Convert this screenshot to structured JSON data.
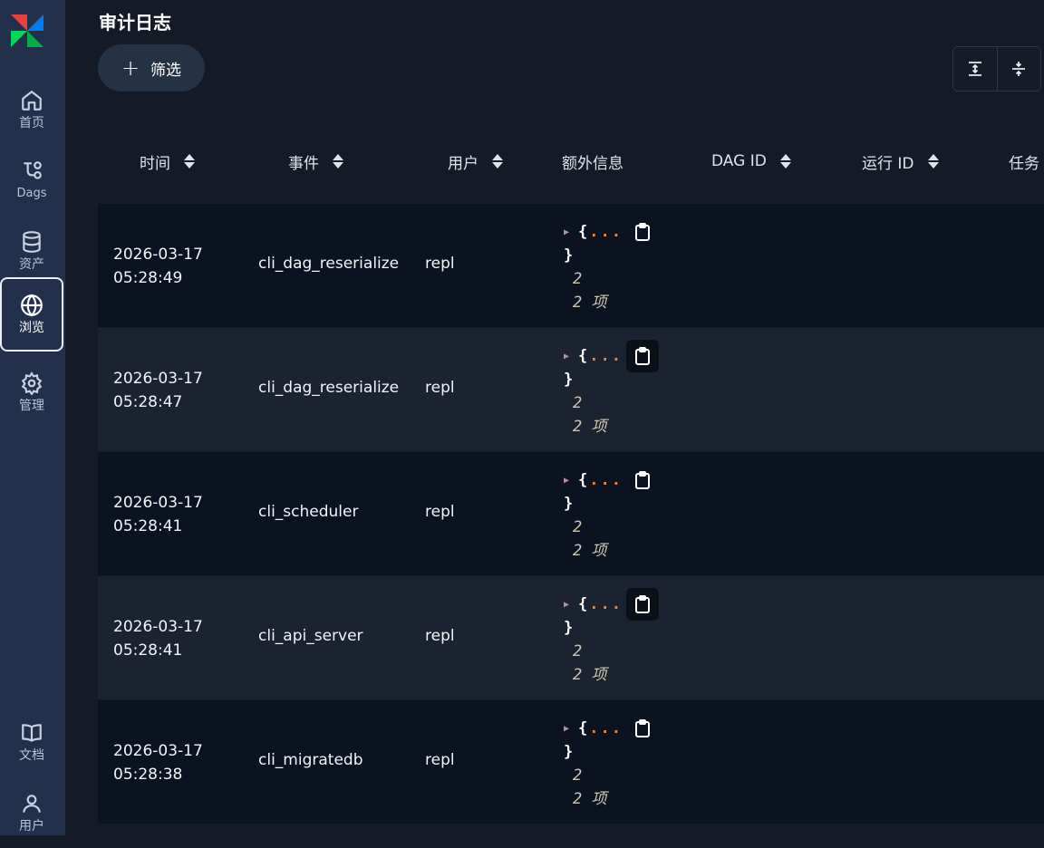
{
  "page": {
    "title": "审计日志"
  },
  "toolbar": {
    "filter_label": "筛选"
  },
  "sidebar": {
    "items": [
      {
        "label": "首页",
        "icon": "home-icon"
      },
      {
        "label": "Dags",
        "icon": "dag-icon"
      },
      {
        "label": "资产",
        "icon": "database-icon"
      },
      {
        "label": "浏览",
        "icon": "globe-icon",
        "active": true
      },
      {
        "label": "管理",
        "icon": "gear-icon"
      },
      {
        "label": "文档",
        "icon": "book-icon"
      },
      {
        "label": "用户",
        "icon": "user-icon"
      }
    ]
  },
  "table": {
    "columns": [
      "时间",
      "事件",
      "用户",
      "额外信息",
      "DAG ID",
      "运行 ID",
      "任务"
    ],
    "rows": [
      {
        "date": "2026-03-17",
        "time": "05:28:49",
        "event": "cli_dag_reserialize",
        "user": "repl",
        "extra_count": "2",
        "extra_items": "2 项"
      },
      {
        "date": "2026-03-17",
        "time": "05:28:47",
        "event": "cli_dag_reserialize",
        "user": "repl",
        "extra_count": "2",
        "extra_items": "2 项"
      },
      {
        "date": "2026-03-17",
        "time": "05:28:41",
        "event": "cli_scheduler",
        "user": "repl",
        "extra_count": "2",
        "extra_items": "2 项"
      },
      {
        "date": "2026-03-17",
        "time": "05:28:41",
        "event": "cli_api_server",
        "user": "repl",
        "extra_count": "2",
        "extra_items": "2 项"
      },
      {
        "date": "2026-03-17",
        "time": "05:28:38",
        "event": "cli_migratedb",
        "user": "repl",
        "extra_count": "2",
        "extra_items": "2 项"
      }
    ],
    "json_open": "{",
    "json_ellipsis": "...",
    "json_close": "}"
  },
  "colors": {
    "sidebar": "#22304b",
    "background": "#141a26",
    "row_dark": "#0c1320",
    "row_light": "#1b2230",
    "accent_orange": "#e0874a"
  }
}
